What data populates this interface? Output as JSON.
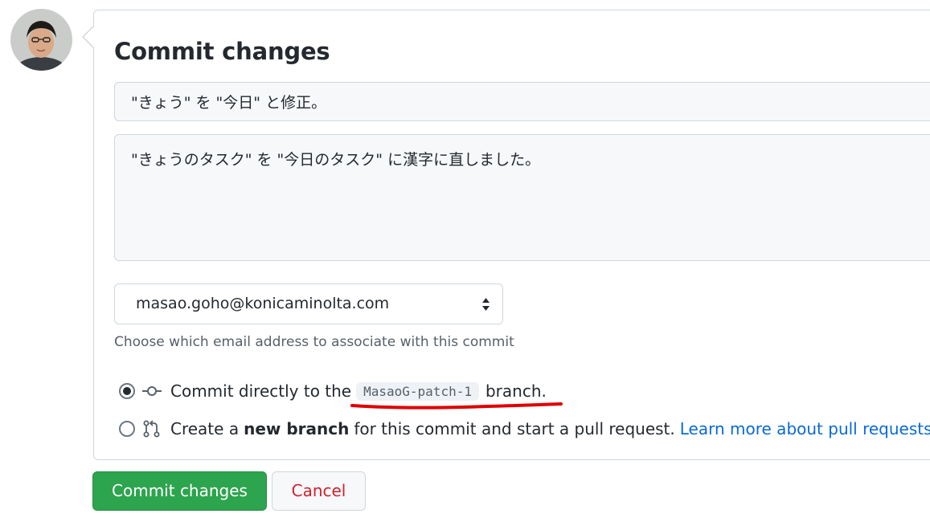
{
  "form": {
    "title": "Commit changes",
    "summary_value": "\"きょう\" を \"今日\" と修正。",
    "description_value": "\"きょうのタスク\" を \"今日のタスク\" に漢字に直しました。"
  },
  "email": {
    "selected": "masao.goho@konicaminolta.com",
    "hint": "Choose which email address to associate with this commit"
  },
  "options": {
    "direct_prefix": "Commit directly to the",
    "branch_name": "MasaoG-patch-1",
    "direct_suffix": "branch.",
    "new_prefix": "Create a",
    "new_bold": "new branch",
    "new_suffix": "for this commit and start a pull request.",
    "learn_more": "Learn more about pull requests."
  },
  "buttons": {
    "commit": "Commit changes",
    "cancel": "Cancel"
  },
  "colors": {
    "commit_green": "#2da44e",
    "cancel_red": "#cf222e",
    "link_blue": "#0969da",
    "annotation_red": "#e00000"
  },
  "icons": {
    "avatar": "user-avatar",
    "caret": "select-caret-icon",
    "commit": "git-commit-icon",
    "pull_request": "git-pull-request-icon"
  }
}
